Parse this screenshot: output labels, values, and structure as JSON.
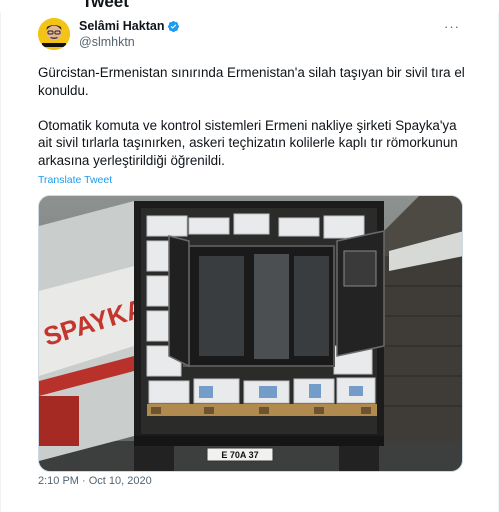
{
  "header": {
    "title": "Tweet"
  },
  "tweet": {
    "author": {
      "display_name": "Selâmi Haktan",
      "handle": "@slmhktn",
      "verified": true
    },
    "text_p1": "Gürcistan-Ermenistan sınırında Ermenistan'a silah taşıyan bir sivil tıra el konuldu.",
    "text_p2": "Otomatik komuta ve kontrol sistemleri Ermeni nakliye şirketi Spayka'ya ait sivil tırlarla taşınırken, askeri teçhizatın kolilerle kaplı tır römorkunun arkasına yerleştirildiği öğrenildi.",
    "translate_label": "Translate Tweet",
    "timestamp": "2:10 PM · Oct 10, 2020",
    "media": {
      "truck_brand_text": "SPAYKA",
      "plate_text": "E 70A 37"
    }
  },
  "icons": {
    "verified": "verified-badge-icon",
    "more": "more-options-icon"
  },
  "colors": {
    "link": "#1d9bf0",
    "verified": "#1d9bf0",
    "secondary_text": "#536471",
    "avatar_bg": "#f3c316"
  }
}
